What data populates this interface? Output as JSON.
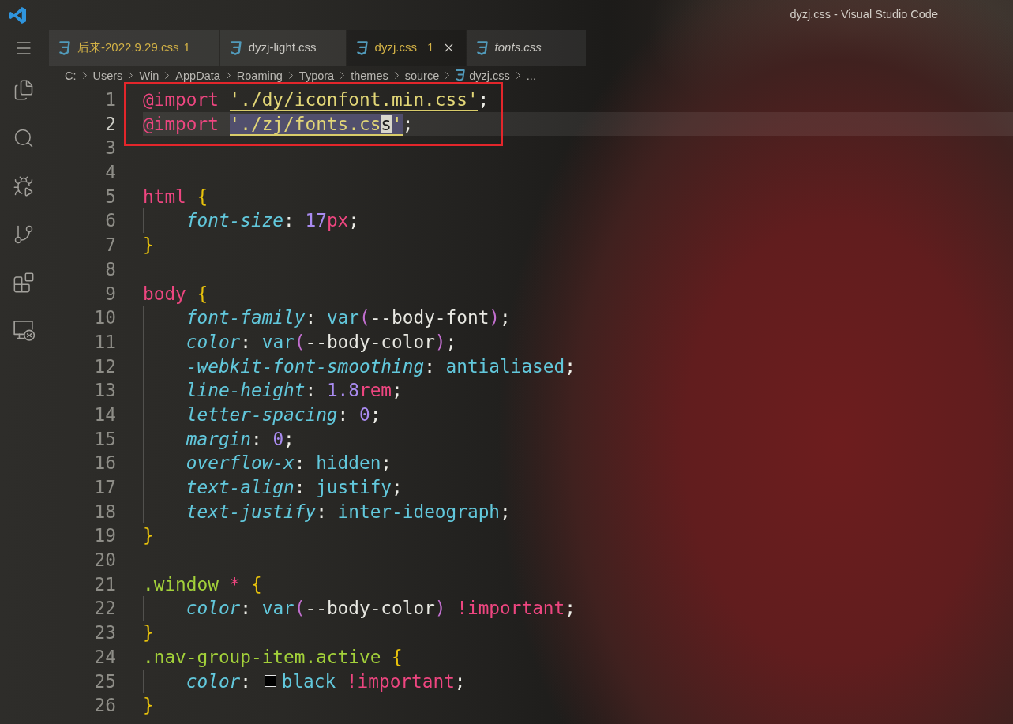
{
  "window": {
    "title": "dyzj.css - Visual Studio Code"
  },
  "tabs": [
    {
      "label": "后来-2022.9.29.css",
      "badge": "1",
      "selected": false,
      "preview": false
    },
    {
      "label": "dyzj-light.css",
      "selected": false,
      "preview": false
    },
    {
      "label": "dyzj.css",
      "badge": "1",
      "selected": true,
      "preview": false
    },
    {
      "label": "fonts.css",
      "selected": false,
      "preview": true
    }
  ],
  "breadcrumb": [
    {
      "label": "C:",
      "kind": "folder"
    },
    {
      "label": "Users",
      "kind": "folder"
    },
    {
      "label": "Win",
      "kind": "folder"
    },
    {
      "label": "AppData",
      "kind": "folder"
    },
    {
      "label": "Roaming",
      "kind": "folder"
    },
    {
      "label": "Typora",
      "kind": "folder"
    },
    {
      "label": "themes",
      "kind": "folder"
    },
    {
      "label": "source",
      "kind": "folder"
    },
    {
      "label": "dyzj.css",
      "kind": "file"
    },
    {
      "label": "...",
      "kind": "more"
    }
  ],
  "editor": {
    "lines": [
      {
        "number": "1",
        "current": false,
        "boxed": true,
        "tokens": [
          {
            "text": "@import ",
            "kind": "atrule",
            "link": false
          },
          {
            "text": "'./dy/iconfont.min.css'",
            "kind": "string",
            "link": true
          },
          {
            "text": ";",
            "kind": "punctuation",
            "link": false
          }
        ]
      },
      {
        "number": "2",
        "current": true,
        "boxed": true,
        "tokens": [
          {
            "text": "@import ",
            "kind": "atrule",
            "link": false,
            "selected": false,
            "cursor": false
          },
          {
            "text": "'./zj/fonts.cs",
            "kind": "string",
            "link": true,
            "selected": true,
            "cursor": false
          },
          {
            "text": "s",
            "kind": "string",
            "link": true,
            "selected": true,
            "cursor": true
          },
          {
            "text": "'",
            "kind": "string",
            "link": true,
            "selected": true,
            "cursor": false
          },
          {
            "text": ";",
            "kind": "punctuation",
            "link": false,
            "selected": false,
            "cursor": false
          }
        ]
      },
      {
        "number": "3",
        "current": false,
        "boxed": false
      },
      {
        "number": "4",
        "current": false,
        "boxed": false
      },
      {
        "number": "5",
        "current": false,
        "boxed": false,
        "tokens": [
          {
            "text": "html",
            "kind": "tag"
          },
          {
            "text": " {",
            "kind": "brace"
          }
        ],
        "children": [
          {
            "number": "6",
            "current": false,
            "boxed": false,
            "tokens": [
              {
                "text": "font-size",
                "kind": "property"
              },
              {
                "text": ": ",
                "kind": "punctuation"
              },
              {
                "text": "17",
                "kind": "number"
              },
              {
                "text": "px",
                "kind": "unit"
              },
              {
                "text": ";",
                "kind": "punctuation"
              }
            ]
          }
        ]
      },
      {
        "number": "7",
        "current": false,
        "boxed": false,
        "tokens": [
          {
            "text": "}",
            "kind": "brace"
          }
        ]
      },
      {
        "number": "8",
        "current": false,
        "boxed": false
      },
      {
        "number": "9",
        "current": false,
        "boxed": false,
        "tokens": [
          {
            "text": "body",
            "kind": "tag"
          },
          {
            "text": " {",
            "kind": "brace"
          }
        ],
        "children": [
          {
            "number": "10",
            "current": false,
            "boxed": false,
            "tokens": [
              {
                "text": "font-family",
                "kind": "property"
              },
              {
                "text": ": ",
                "kind": "punctuation"
              },
              {
                "text": "var",
                "kind": "function"
              },
              {
                "text": "(",
                "kind": "paren"
              },
              {
                "text": "--body-font",
                "kind": "variable"
              },
              {
                "text": ")",
                "kind": "paren"
              },
              {
                "text": ";",
                "kind": "punctuation"
              }
            ]
          },
          {
            "number": "11",
            "current": false,
            "boxed": false,
            "tokens": [
              {
                "text": "color",
                "kind": "property"
              },
              {
                "text": ": ",
                "kind": "punctuation"
              },
              {
                "text": "var",
                "kind": "function"
              },
              {
                "text": "(",
                "kind": "paren"
              },
              {
                "text": "--body-color",
                "kind": "variable"
              },
              {
                "text": ")",
                "kind": "paren"
              },
              {
                "text": ";",
                "kind": "punctuation"
              }
            ]
          },
          {
            "number": "12",
            "current": false,
            "boxed": false,
            "tokens": [
              {
                "text": "-webkit-font-smoothing",
                "kind": "property"
              },
              {
                "text": ": ",
                "kind": "punctuation"
              },
              {
                "text": "antialiased",
                "kind": "keyword"
              },
              {
                "text": ";",
                "kind": "punctuation"
              }
            ]
          },
          {
            "number": "13",
            "current": false,
            "boxed": false,
            "tokens": [
              {
                "text": "line-height",
                "kind": "property"
              },
              {
                "text": ": ",
                "kind": "punctuation"
              },
              {
                "text": "1.8",
                "kind": "number"
              },
              {
                "text": "rem",
                "kind": "unit"
              },
              {
                "text": ";",
                "kind": "punctuation"
              }
            ]
          },
          {
            "number": "14",
            "current": false,
            "boxed": false,
            "tokens": [
              {
                "text": "letter-spacing",
                "kind": "property"
              },
              {
                "text": ": ",
                "kind": "punctuation"
              },
              {
                "text": "0",
                "kind": "number"
              },
              {
                "text": ";",
                "kind": "punctuation"
              }
            ]
          },
          {
            "number": "15",
            "current": false,
            "boxed": false,
            "tokens": [
              {
                "text": "margin",
                "kind": "property"
              },
              {
                "text": ": ",
                "kind": "punctuation"
              },
              {
                "text": "0",
                "kind": "number"
              },
              {
                "text": ";",
                "kind": "punctuation"
              }
            ]
          },
          {
            "number": "16",
            "current": false,
            "boxed": false,
            "tokens": [
              {
                "text": "overflow-x",
                "kind": "property"
              },
              {
                "text": ": ",
                "kind": "punctuation"
              },
              {
                "text": "hidden",
                "kind": "keyword"
              },
              {
                "text": ";",
                "kind": "punctuation"
              }
            ]
          },
          {
            "number": "17",
            "current": false,
            "boxed": false,
            "tokens": [
              {
                "text": "text-align",
                "kind": "property"
              },
              {
                "text": ": ",
                "kind": "punctuation"
              },
              {
                "text": "justify",
                "kind": "keyword"
              },
              {
                "text": ";",
                "kind": "punctuation"
              }
            ]
          },
          {
            "number": "18",
            "current": false,
            "boxed": false,
            "tokens": [
              {
                "text": "text-justify",
                "kind": "property"
              },
              {
                "text": ": ",
                "kind": "punctuation"
              },
              {
                "text": "inter-ideograph",
                "kind": "keyword"
              },
              {
                "text": ";",
                "kind": "punctuation"
              }
            ]
          }
        ]
      },
      {
        "number": "19",
        "current": false,
        "boxed": false,
        "tokens": [
          {
            "text": "}",
            "kind": "brace"
          }
        ]
      },
      {
        "number": "20",
        "current": false,
        "boxed": false
      },
      {
        "number": "21",
        "current": false,
        "boxed": false,
        "tokens": [
          {
            "text": ".window",
            "kind": "class"
          },
          {
            "text": " *",
            "kind": "operator"
          },
          {
            "text": " {",
            "kind": "brace"
          }
        ],
        "children": [
          {
            "number": "22",
            "current": false,
            "boxed": false,
            "tokens": [
              {
                "text": "color",
                "kind": "property"
              },
              {
                "text": ": ",
                "kind": "punctuation"
              },
              {
                "text": "var",
                "kind": "function"
              },
              {
                "text": "(",
                "kind": "paren"
              },
              {
                "text": "--body-color",
                "kind": "variable"
              },
              {
                "text": ")",
                "kind": "paren"
              },
              {
                "text": " !important",
                "kind": "important"
              },
              {
                "text": ";",
                "kind": "punctuation"
              }
            ]
          }
        ]
      },
      {
        "number": "23",
        "current": false,
        "boxed": false,
        "tokens": [
          {
            "text": "}",
            "kind": "brace"
          }
        ]
      },
      {
        "number": "24",
        "current": false,
        "boxed": false,
        "tokens": [
          {
            "text": ".nav-group-item.active",
            "kind": "class"
          },
          {
            "text": " {",
            "kind": "brace"
          }
        ],
        "children": [
          {
            "number": "25",
            "current": false,
            "boxed": false,
            "tokens": [
              {
                "text": "color",
                "kind": "property"
              },
              {
                "text": ": ",
                "kind": "punctuation"
              },
              {
                "kind": "swatch",
                "color": "#000000"
              },
              {
                "text": "black",
                "kind": "keyword"
              },
              {
                "text": " !important",
                "kind": "important"
              },
              {
                "text": ";",
                "kind": "punctuation"
              }
            ]
          }
        ]
      },
      {
        "number": "26",
        "current": false,
        "boxed": false,
        "tokens": [
          {
            "text": "}",
            "kind": "brace"
          }
        ]
      }
    ]
  }
}
